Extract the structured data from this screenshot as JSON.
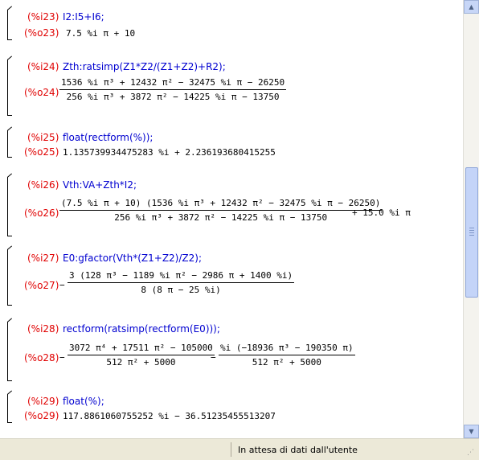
{
  "cells": [
    {
      "in_label": "(%i23)",
      "input": "I2:I5+I6;",
      "out_label": "(%o23)",
      "output": "7.5 %i π + 10"
    },
    {
      "in_label": "(%i24)",
      "input": "Zth:ratsimp(Z1*Z2/(Z1+Z2)+R2);",
      "out_label": "(%o24)",
      "num": "1536 %i π³ + 12432 π² − 32475 %i π − 26250",
      "den": "256 %i π³ + 3872 π² − 14225 %i π − 13750"
    },
    {
      "in_label": "(%i25)",
      "input": "float(rectform(%));",
      "out_label": "(%o25)",
      "output": "1.135739934475283 %i + 2.236193680415255"
    },
    {
      "in_label": "(%i26)",
      "input": "Vth:VA+Zth*I2;",
      "out_label": "(%o26)",
      "num": "(7.5 %i π + 10) (1536 %i π³ + 12432 π² − 32475 %i π − 26250)",
      "den": "256 %i π³ + 3872 π² − 14225 %i π − 13750",
      "tail": "+ 15.0 %i π"
    },
    {
      "in_label": "(%i27)",
      "input": "E0:gfactor(Vth*(Z1+Z2)/Z2);",
      "out_label": "(%o27)",
      "num": "3 (128 π³ − 1189 %i π² − 2986 π + 1400 %i)",
      "den": "8 (8 π − 25 %i)"
    },
    {
      "in_label": "(%i28)",
      "input": "rectform(ratsimp(rectform(E0)));",
      "out_label": "(%o28)",
      "num": "3072 π⁴ + 17511 π² − 105000",
      "den": "512 π² + 5000",
      "num2": "%i (−18936 π³ − 190350 π)",
      "den2": "512 π² + 5000"
    },
    {
      "in_label": "(%i29)",
      "input": "float(%);",
      "out_label": "(%o29)",
      "output": "117.8861060755252 %i − 36.51235455513207"
    }
  ],
  "status": {
    "text": "In attesa di dati dall'utente"
  },
  "scroll": {
    "position_fraction": 0.62
  }
}
